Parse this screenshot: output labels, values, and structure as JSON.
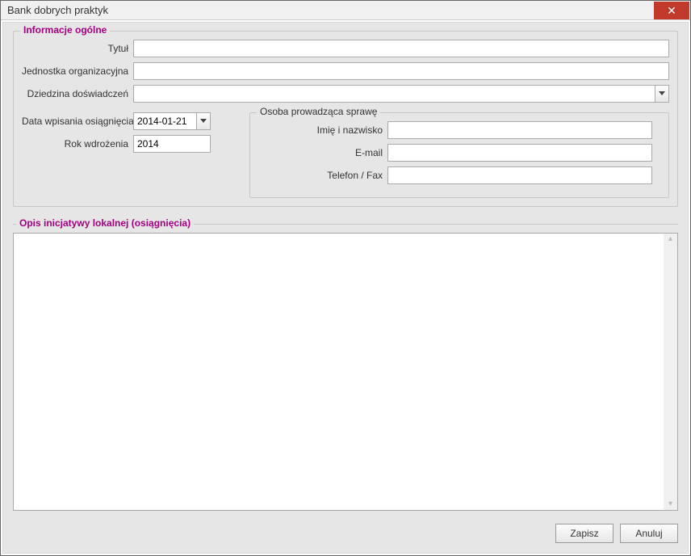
{
  "window": {
    "title": "Bank dobrych praktyk"
  },
  "fieldset_general": {
    "legend": "Informacje ogólne",
    "labels": {
      "title": "Tytuł",
      "org_unit": "Jednostka organizacyjna",
      "domain": "Dziedzina doświadczeń",
      "entry_date": "Data wpisania osiągnięcia",
      "year": "Rok wdrożenia"
    },
    "values": {
      "title": "",
      "org_unit": "",
      "domain": "",
      "entry_date": "2014-01-21",
      "year": "2014"
    }
  },
  "fieldset_contact": {
    "legend": "Osoba prowadząca sprawę",
    "labels": {
      "name": "Imię i nazwisko",
      "email": "E-mail",
      "phone": "Telefon / Fax"
    },
    "values": {
      "name": "",
      "email": "",
      "phone": ""
    }
  },
  "section_desc": {
    "legend": "Opis inicjatywy lokalnej (osiągnięcia)",
    "value": ""
  },
  "buttons": {
    "save": "Zapisz",
    "cancel": "Anuluj"
  }
}
